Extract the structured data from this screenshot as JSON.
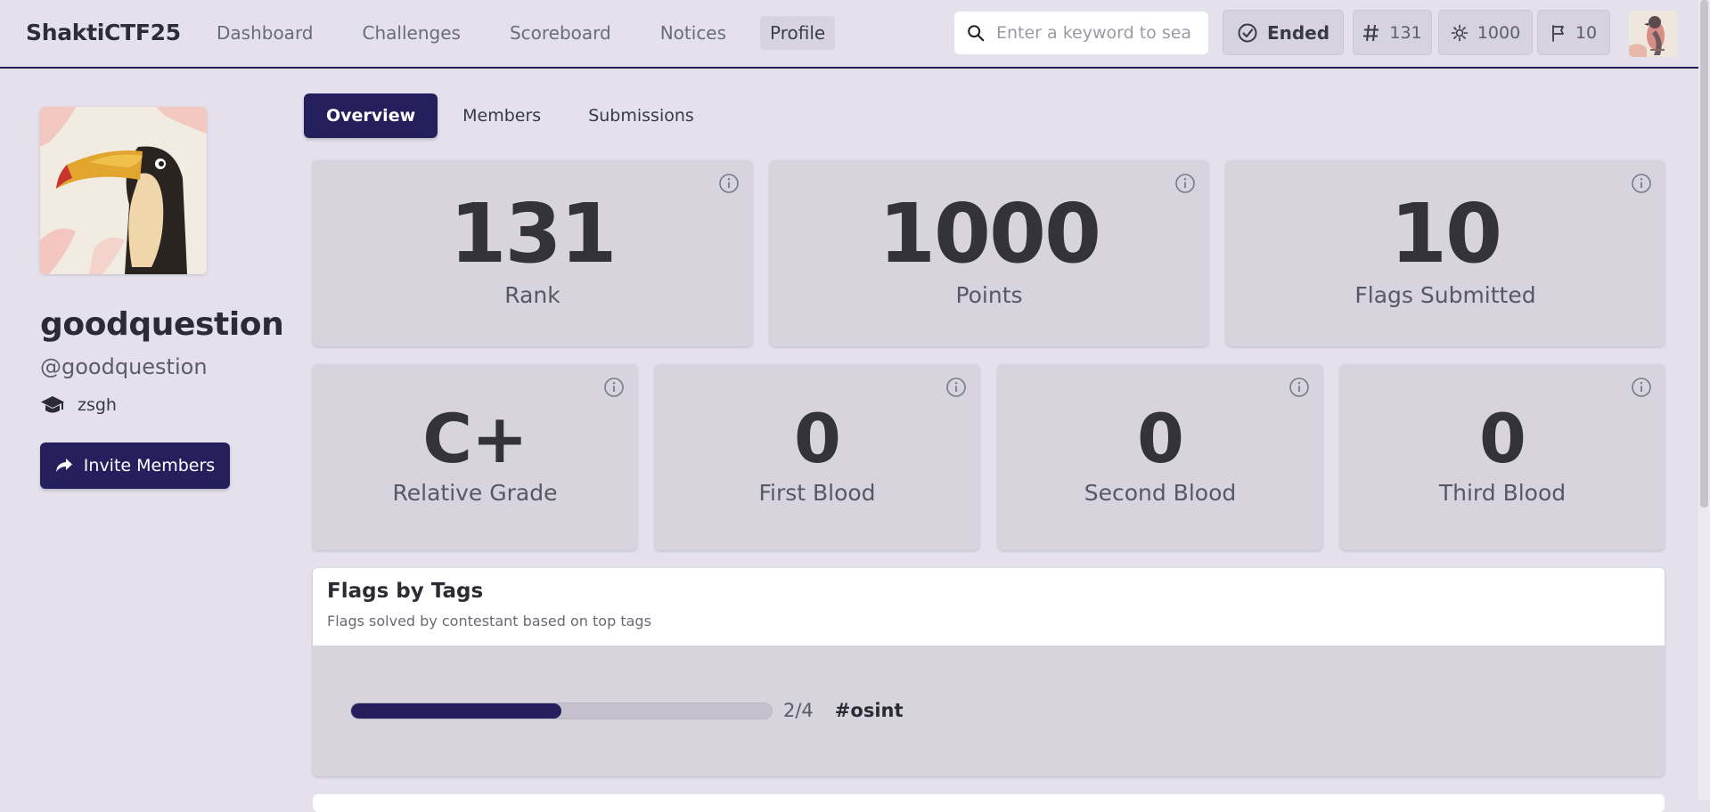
{
  "brand": "ShaktiCTF25",
  "nav": [
    {
      "label": "Dashboard",
      "active": false
    },
    {
      "label": "Challenges",
      "active": false
    },
    {
      "label": "Scoreboard",
      "active": false
    },
    {
      "label": "Notices",
      "active": false
    },
    {
      "label": "Profile",
      "active": true
    }
  ],
  "search": {
    "placeholder": "Enter a keyword to search",
    "value": ""
  },
  "status": {
    "ended_label": "Ended",
    "rank": "131",
    "points": "1000",
    "flags": "10"
  },
  "profile": {
    "name": "goodquestion",
    "handle": "@goodquestion",
    "org": "zsgh",
    "invite_label": "Invite Members"
  },
  "tabs": [
    {
      "label": "Overview",
      "active": true
    },
    {
      "label": "Members",
      "active": false
    },
    {
      "label": "Submissions",
      "active": false
    }
  ],
  "stats_top": [
    {
      "value": "131",
      "label": "Rank"
    },
    {
      "value": "1000",
      "label": "Points"
    },
    {
      "value": "10",
      "label": "Flags Submitted"
    }
  ],
  "stats_bottom": [
    {
      "value": "C+",
      "label": "Relative Grade"
    },
    {
      "value": "0",
      "label": "First Blood"
    },
    {
      "value": "0",
      "label": "Second Blood"
    },
    {
      "value": "0",
      "label": "Third Blood"
    }
  ],
  "flags_by_tags": {
    "title": "Flags by Tags",
    "subtitle": "Flags solved by contestant based on top tags",
    "tags": [
      {
        "name": "#osint",
        "solved": 2,
        "total": 4,
        "count_label": "2/4"
      }
    ]
  },
  "colors": {
    "accent": "#261f5d",
    "background": "#e4e1ec",
    "card": "#d7d4de"
  }
}
